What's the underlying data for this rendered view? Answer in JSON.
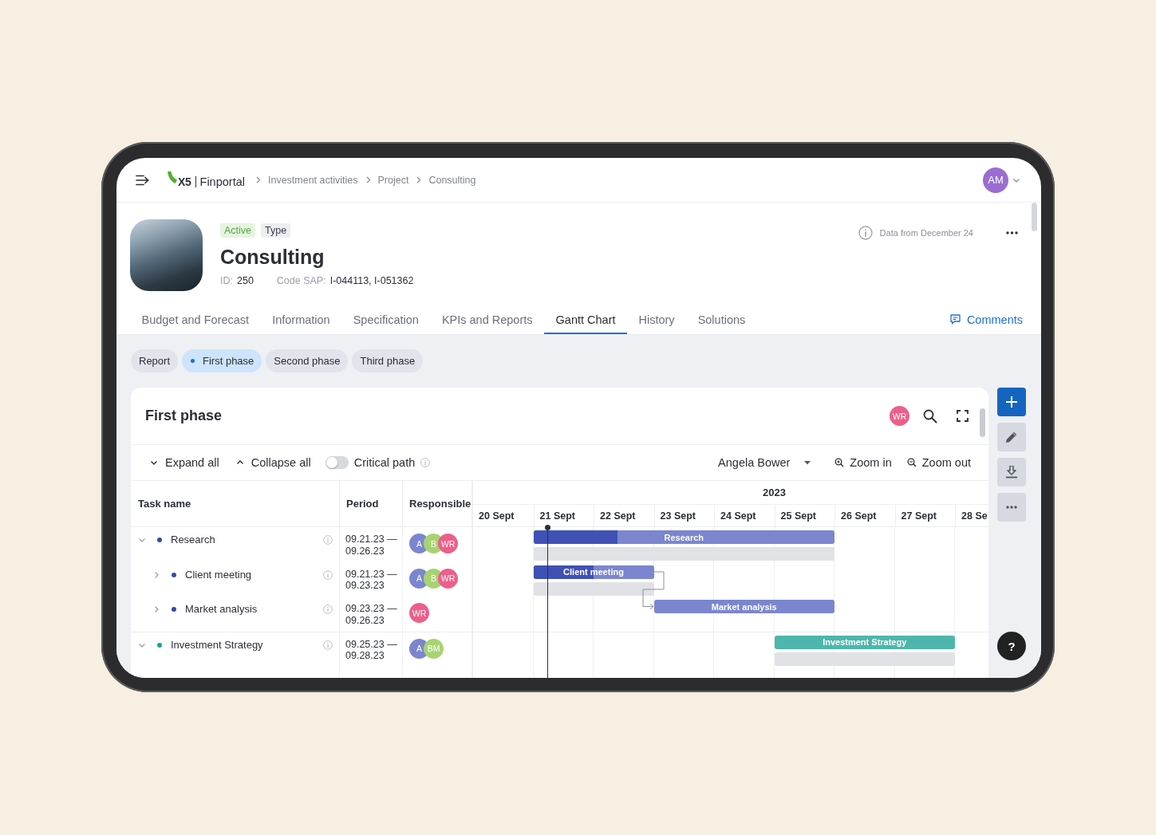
{
  "top_bar": {
    "logo": {
      "mark": "X5",
      "name": "Finportal"
    },
    "breadcrumbs": [
      "Investment activities",
      "Project",
      "Consulting"
    ],
    "user": {
      "initials": "AM",
      "color": "#9b6dd3"
    }
  },
  "project": {
    "tags": [
      {
        "label": "Active",
        "kind": "status"
      },
      {
        "label": "Type",
        "kind": "category"
      }
    ],
    "title": "Consulting",
    "fields": [
      {
        "label": "ID:",
        "value": "250"
      },
      {
        "label": "Code SAP:",
        "value": "I-044113, I-051362"
      }
    ],
    "data_note": "Data from December 24"
  },
  "tabs": [
    {
      "label": "Budget and Forecast",
      "selected": false
    },
    {
      "label": "Information",
      "selected": false
    },
    {
      "label": "Specification",
      "selected": false
    },
    {
      "label": "KPIs and Reports",
      "selected": false
    },
    {
      "label": "Gantt Chart",
      "selected": true
    },
    {
      "label": "History",
      "selected": false
    },
    {
      "label": "Solutions",
      "selected": false
    }
  ],
  "comments": "Comments",
  "phase_chips": [
    {
      "label": "Report",
      "selected": false
    },
    {
      "label": "First phase",
      "selected": true
    },
    {
      "label": "Second phase",
      "selected": false
    },
    {
      "label": "Third phase",
      "selected": false
    }
  ],
  "gantt_panel": {
    "title": "First phase",
    "viewer": {
      "initials": "WR",
      "color": "#ec5f8a"
    },
    "toolbar": {
      "expand_all": "Expand all",
      "collapse_all": "Collapse all",
      "critical_path": {
        "label": "Critical path",
        "on": false
      },
      "assignee": "Angela Bower",
      "zoom_in": "Zoom in",
      "zoom_out": "Zoom out"
    },
    "table": {
      "columns": [
        "Task name",
        "Period",
        "Responsible"
      ],
      "rows": [
        {
          "name": "Research",
          "color": "#3949ab",
          "expanded": true,
          "period": "09.21.23 — 09.26.23",
          "responsible": [
            {
              "initials": "A",
              "color": "#7b86cf"
            },
            {
              "initials": "B",
              "color": "#a8d373"
            },
            {
              "initials": "WR",
              "color": "#ec5f8a"
            }
          ],
          "bar": {
            "label": "Research",
            "color": "#7b86cf",
            "progress": {
              "level": 0.28
            },
            "baseline": true,
            "dependency": false
          },
          "children": [
            {
              "name": "Client meeting",
              "color": "#3949ab",
              "expanded": false,
              "period": "09.21.23 — 09.23.23",
              "responsible": [
                {
                  "initials": "A",
                  "color": "#7b86cf"
                },
                {
                  "initials": "B",
                  "color": "#a8d373"
                },
                {
                  "initials": "WR",
                  "color": "#ec5f8a"
                }
              ],
              "bar": {
                "label": "Client meeting",
                "color": "#7b86cf",
                "progress": {
                  "level": 0.5
                },
                "baseline": true,
                "dependency": false
              }
            },
            {
              "name": "Market analysis",
              "color": "#3949ab",
              "expanded": false,
              "period": "09.23.23 — 09.26.23",
              "responsible": [
                {
                  "initials": "WR",
                  "color": "#ec5f8a"
                }
              ],
              "bar": {
                "label": "Market analysis",
                "color": "#7b86cf",
                "baseline": false,
                "dependency": true
              }
            }
          ]
        },
        {
          "name": "Investment Strategy",
          "color": "#16a394",
          "expanded": true,
          "period": "09.25.23 — 09.28.23",
          "responsible": [
            {
              "initials": "A",
              "color": "#7b86cf"
            },
            {
              "initials": "BM",
              "color": "#a8d373"
            }
          ],
          "bar": {
            "label": "Investment Strategy",
            "color": "#4db6ac",
            "baseline": true,
            "dependency": false
          }
        }
      ]
    },
    "timeline": {
      "year": "2023",
      "days": [
        {
          "label": "20 Sept",
          "today": false
        },
        {
          "label": "21 Sept",
          "today": true
        },
        {
          "label": "22 Sept",
          "today": false
        },
        {
          "label": "23 Sept",
          "today": false
        },
        {
          "label": "24 Sept",
          "today": false
        },
        {
          "label": "25 Sept",
          "today": false
        },
        {
          "label": "26 Sept",
          "today": false
        },
        {
          "label": "27 Sept",
          "today": false
        },
        {
          "label": "28 Se",
          "today": false
        }
      ]
    }
  },
  "help": "?"
}
